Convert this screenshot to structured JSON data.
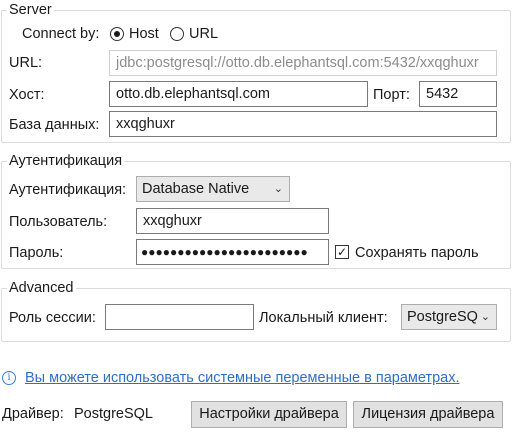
{
  "server": {
    "group_title": "Server",
    "connect_by_label": "Connect by:",
    "host_option": "Host",
    "url_option": "URL",
    "selected": "Host",
    "url_label": "URL:",
    "url_value": "jdbc:postgresql://otto.db.elephantsql.com:5432/xxqghuxr",
    "host_label": "Хост:",
    "host_value": "otto.db.elephantsql.com",
    "port_label": "Порт:",
    "port_value": "5432",
    "database_label": "База данных:",
    "database_value": "xxqghuxr"
  },
  "auth": {
    "group_title": "Аутентификация",
    "auth_label": "Аутентификация:",
    "auth_value": "Database Native",
    "user_label": "Пользователь:",
    "user_value": "xxqghuxr",
    "password_label": "Пароль:",
    "password_value": "●●●●●●●●●●●●●●●●●●●●●●●",
    "save_password_label": "Сохранять пароль",
    "save_password_checked": true
  },
  "advanced": {
    "group_title": "Advanced",
    "session_role_label": "Роль сессии:",
    "session_role_value": "",
    "local_client_label": "Локальный клиент:",
    "local_client_value": "PostgreSQ"
  },
  "info": {
    "icon": "info-icon",
    "link_text": "Вы можете использовать системные переменные в параметрах."
  },
  "footer": {
    "driver_label": "Драйвер:",
    "driver_value": "PostgreSQL",
    "driver_settings_button": "Настройки драйвера",
    "driver_license_button": "Лицензия драйвера"
  }
}
